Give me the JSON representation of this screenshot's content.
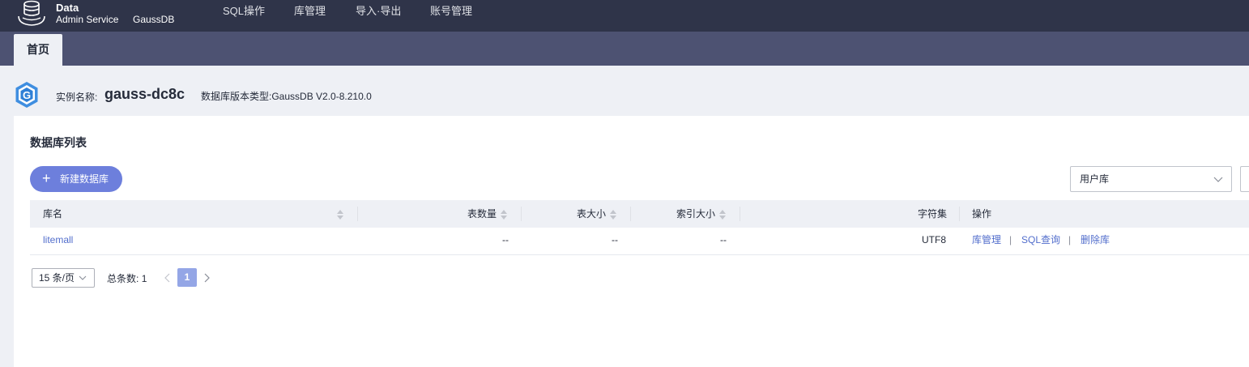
{
  "header": {
    "logo_line1": "Data",
    "logo_line2": "Admin Service",
    "product": "GaussDB",
    "nav": [
      "SQL操作",
      "库管理",
      "导入·导出",
      "账号管理"
    ]
  },
  "tabs": {
    "home": "首页"
  },
  "instance": {
    "name_label": "实例名称:",
    "name": "gauss-dc8c",
    "type_label": "数据库版本类型:",
    "type": "GaussDB V2.0-8.210.0"
  },
  "list": {
    "title": "数据库列表",
    "new_button": "新建数据库",
    "filter_value": "用户库",
    "columns": [
      "库名",
      "表数量",
      "表大小",
      "索引大小",
      "字符集",
      "操作"
    ],
    "rows": [
      {
        "name": "litemall",
        "table_count": "--",
        "table_size": "--",
        "index_size": "--",
        "charset": "UTF8",
        "ops": [
          "库管理",
          "SQL查询",
          "删除库"
        ],
        "op_sep": "|"
      }
    ]
  },
  "pagination": {
    "page_size": "15 条/页",
    "total_label": "总条数:",
    "total": "1",
    "current_page": "1"
  },
  "colors": {
    "topbar": "#2f3449",
    "tabsbar": "#4d5272",
    "primary_button": "#6d7fdc",
    "link": "#526ecc",
    "active_page": "#94a6e6"
  },
  "icons": {
    "logo": "database-cylinder-icon",
    "instance": "gaussdb-logo-icon",
    "plus": "plus-icon",
    "chevron": "chevron-down-icon",
    "sort": "sort-icon",
    "prev": "chevron-left-icon",
    "next": "chevron-right-icon"
  }
}
